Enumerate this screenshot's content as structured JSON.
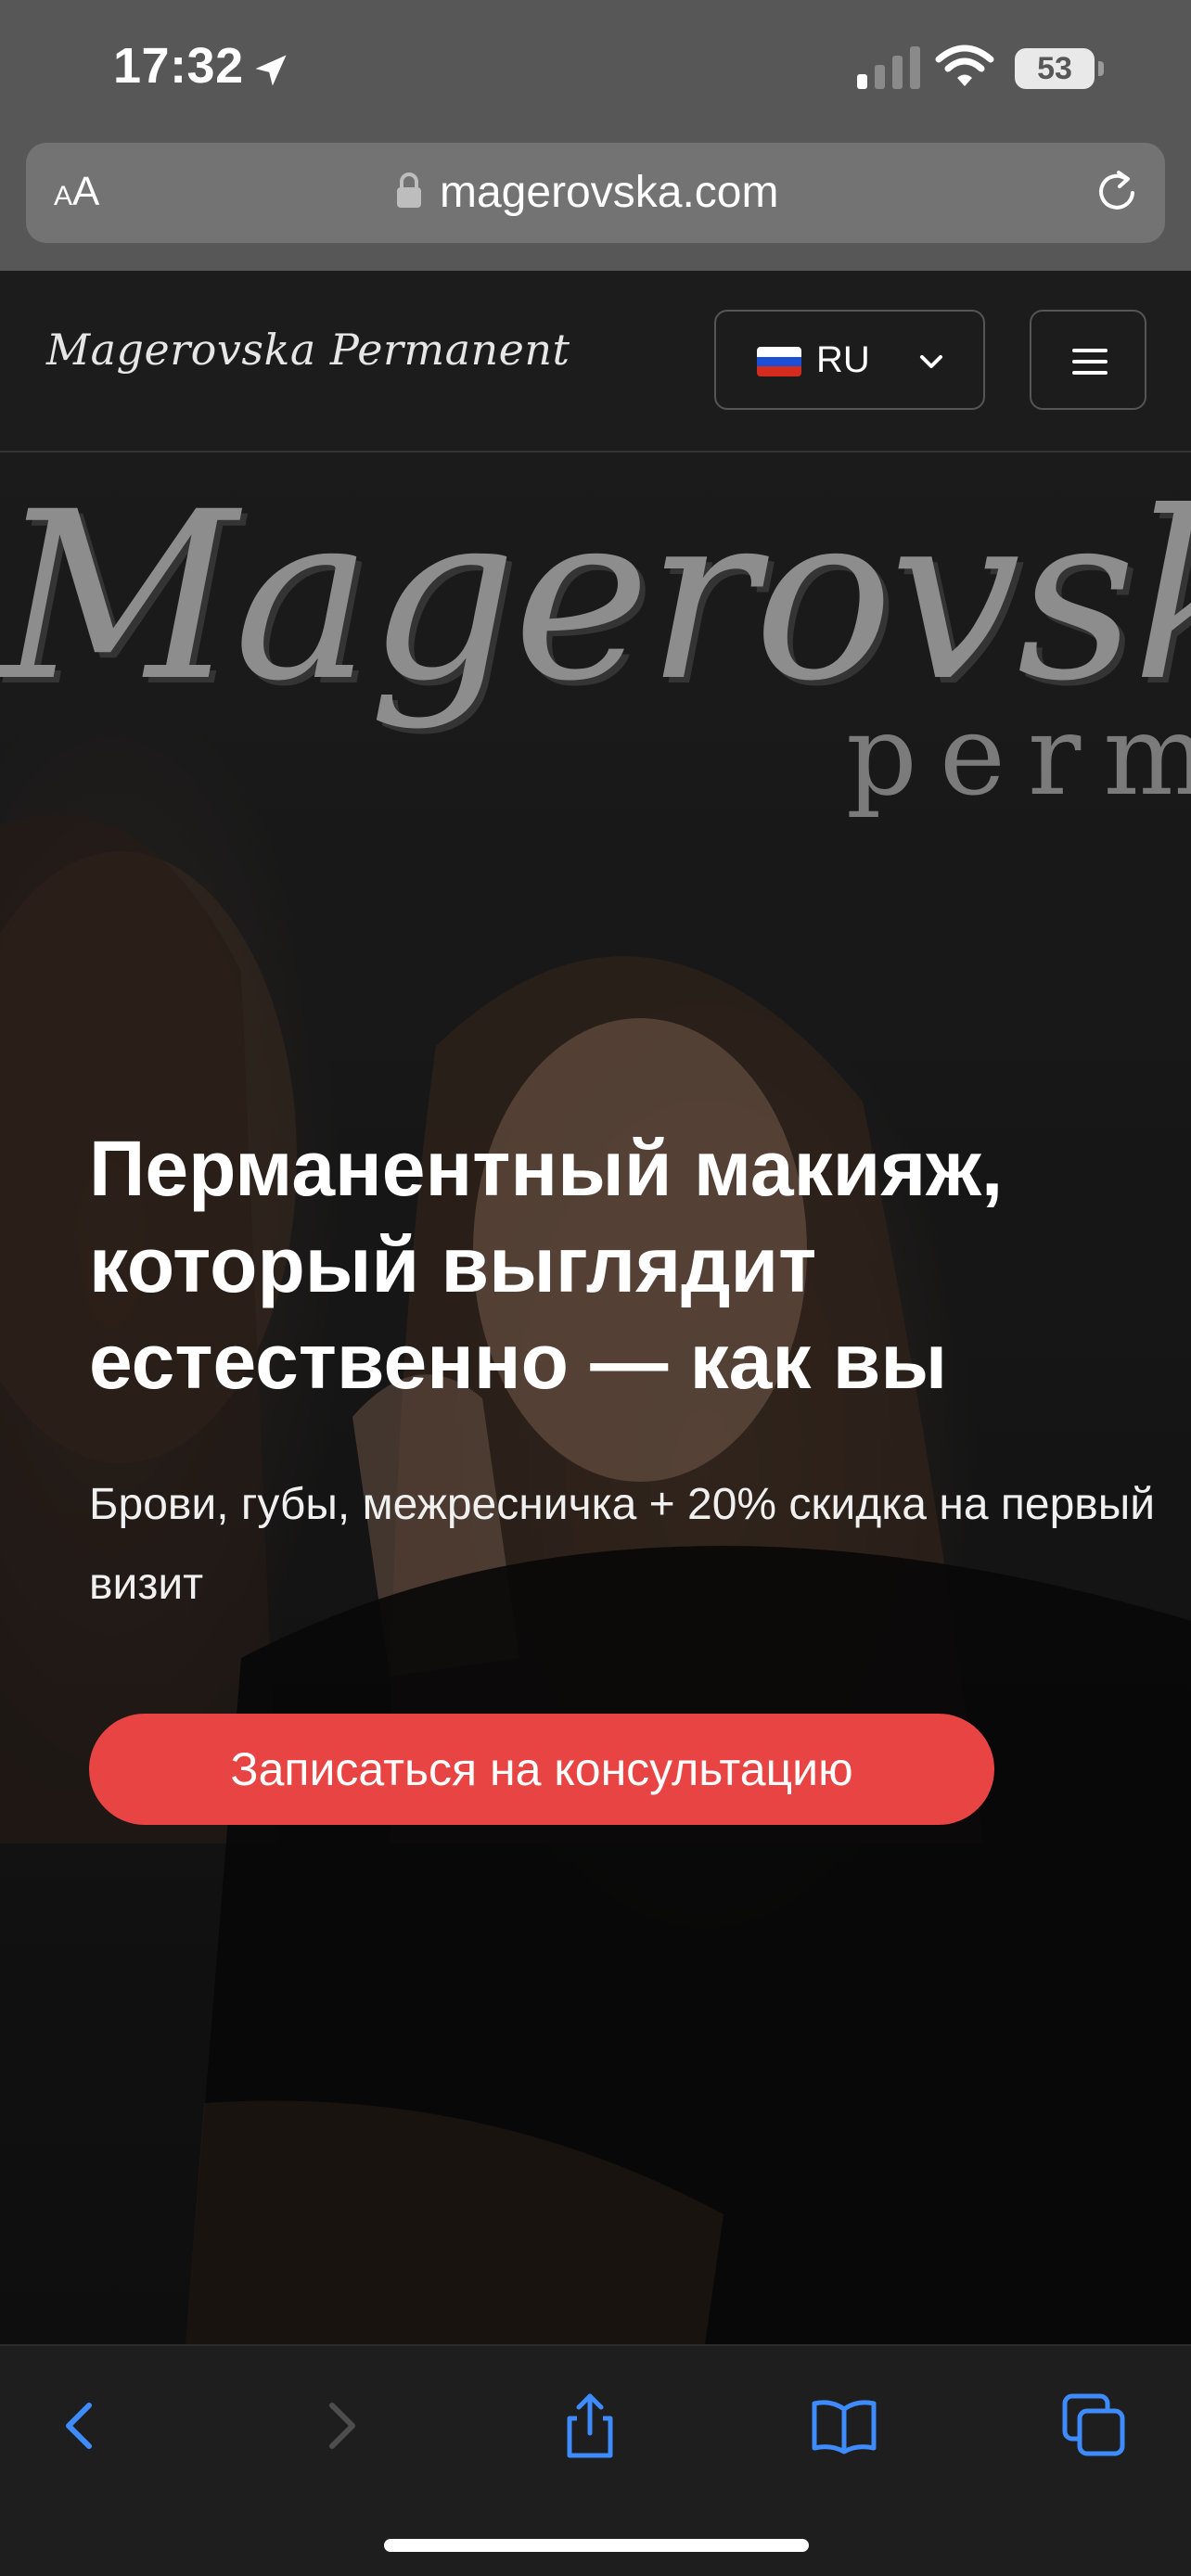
{
  "status_bar": {
    "time": "17:32",
    "battery": "53",
    "icons": [
      "location-arrow-icon",
      "cellular-signal-icon",
      "wifi-icon",
      "battery-icon"
    ]
  },
  "browser": {
    "text_size_button": {
      "small": "A",
      "large": "A"
    },
    "url": "magerovska.com",
    "icons": [
      "lock-icon",
      "reload-icon"
    ]
  },
  "site_header": {
    "logo": "Magerovska Permanent",
    "language": {
      "code": "RU",
      "flag": "russia-flag-icon"
    },
    "menu_icon": "hamburger-menu-icon"
  },
  "hero": {
    "script_text": "Magerovsk",
    "script_sub": "perma",
    "title": "Перманентный макияж, который выглядит естественно — как вы",
    "subtitle": "Брови, губы, межресничка + 20% скидка на первый визит",
    "cta": "Записаться на консультацию"
  },
  "toolbar": {
    "icons": [
      "back-icon",
      "forward-icon",
      "share-icon",
      "bookmarks-icon",
      "tabs-icon"
    ]
  },
  "colors": {
    "accent": "#e94444",
    "link_blue": "#3d8bfd",
    "chrome_gray": "#575757"
  }
}
